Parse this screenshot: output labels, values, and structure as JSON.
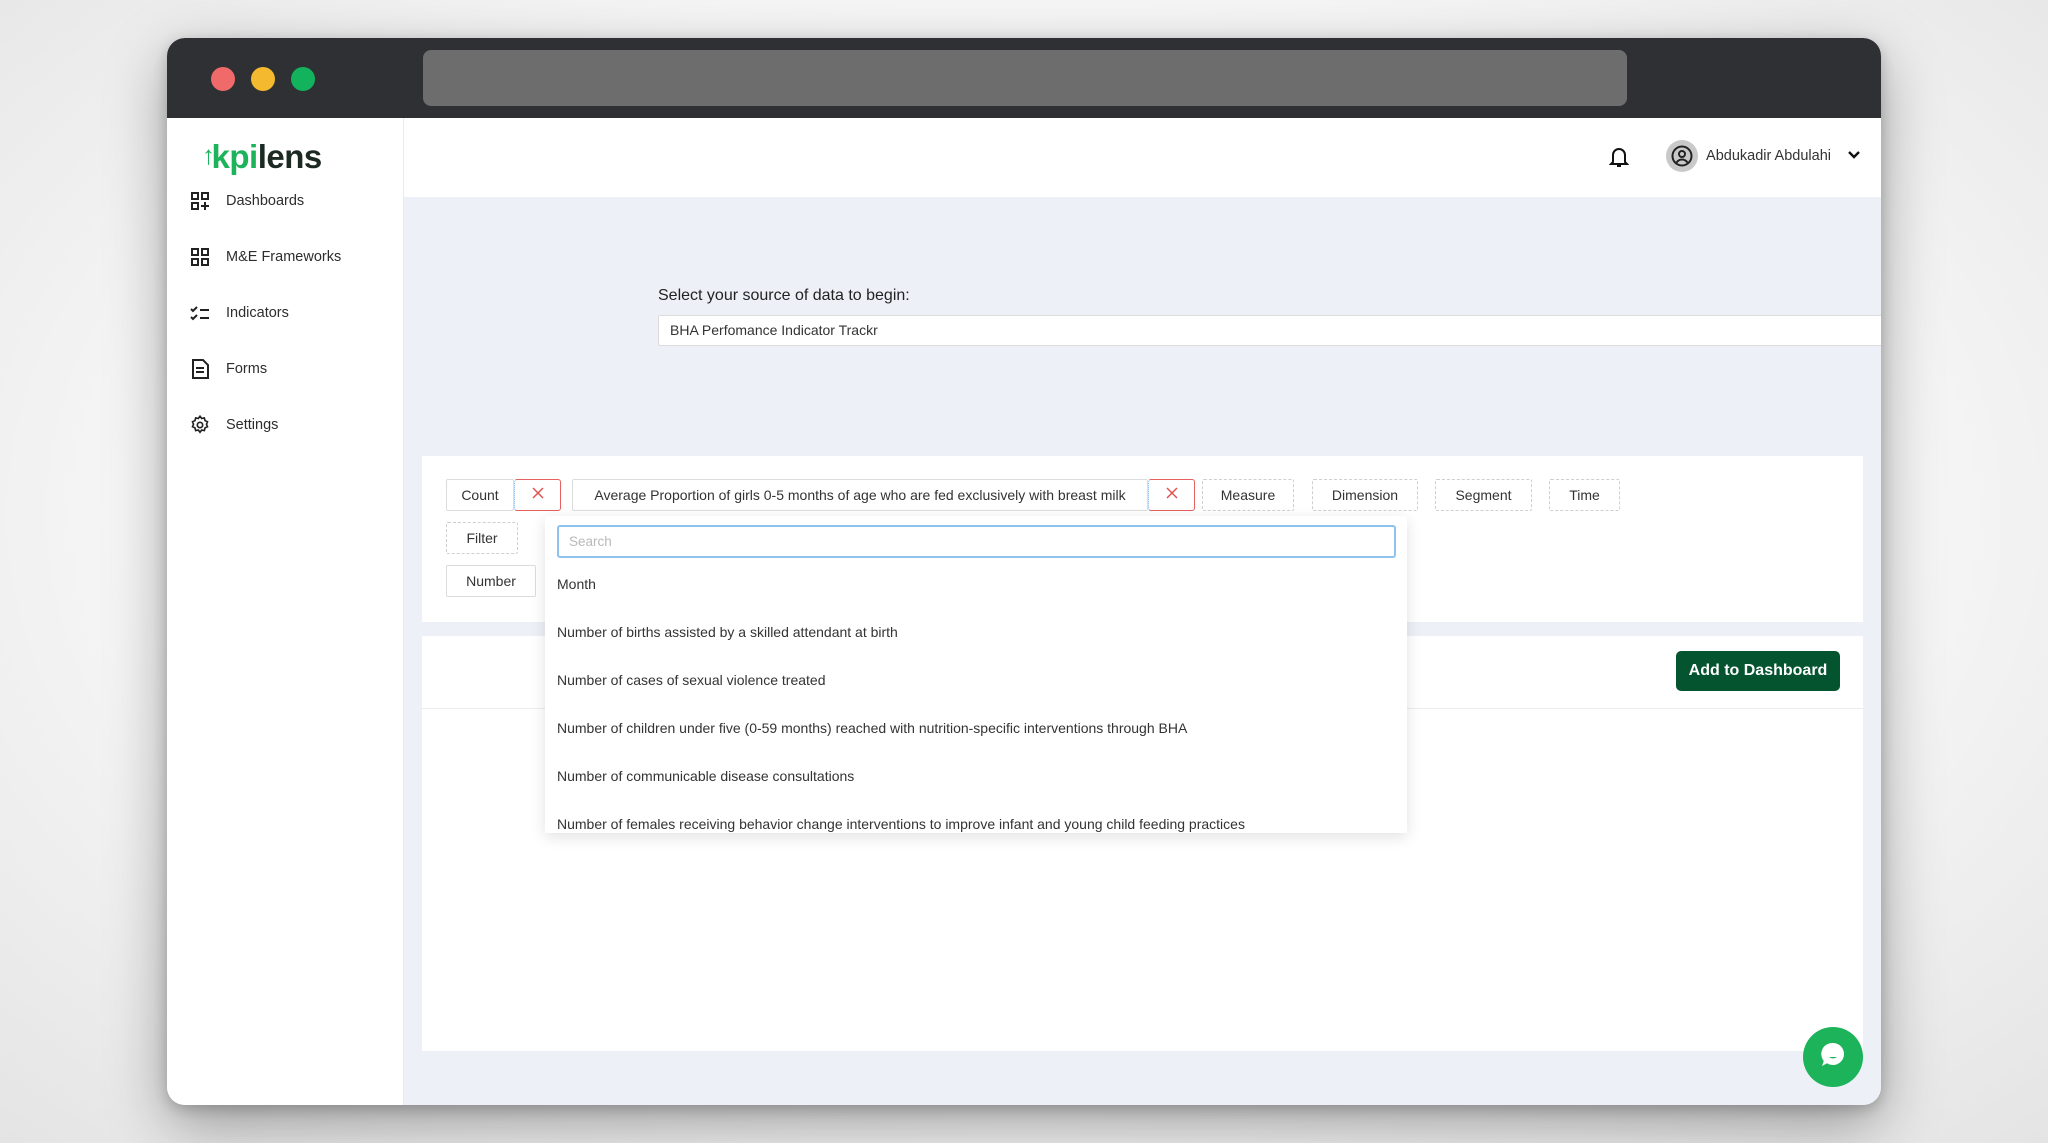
{
  "window": {
    "traffic_lights": [
      "close",
      "minimize",
      "maximize"
    ]
  },
  "brand": {
    "logo_part1": "kpi",
    "logo_part2": "lens",
    "accent": "#1db35b",
    "dark_green": "#03542f"
  },
  "sidebar": {
    "items": [
      {
        "label": "Dashboards",
        "icon": "dashboard-add-icon"
      },
      {
        "label": "M&E Frameworks",
        "icon": "grid-icon"
      },
      {
        "label": "Indicators",
        "icon": "checklist-icon"
      },
      {
        "label": "Forms",
        "icon": "document-icon"
      },
      {
        "label": "Settings",
        "icon": "gear-icon"
      }
    ]
  },
  "header": {
    "user_name": "Abdukadir Abdulahi"
  },
  "source": {
    "label": "Select your source of data to begin:",
    "selected": "BHA Perfomance Indicator Trackr"
  },
  "builder": {
    "count_label": "Count",
    "measure_value": "Average Proportion of girls 0-5 months of age who are fed exclusively with breast milk",
    "remove_symbol": "×",
    "measure_label": "Measure",
    "dimension_label": "Dimension",
    "segment_label": "Segment",
    "time_label": "Time",
    "filter_label": "Filter",
    "number_label": "Number"
  },
  "dropdown": {
    "search_placeholder": "Search",
    "options": [
      "Month",
      "Number of births assisted by a skilled attendant at birth",
      "Number of cases of sexual violence treated",
      "Number of children under five (0-59 months) reached with nutrition-specific interventions through BHA",
      "Number of communicable disease consultations",
      "Number of females receiving behavior change interventions to improve infant and young child feeding practices"
    ]
  },
  "actions": {
    "add_to_dashboard": "Add to Dashboard"
  }
}
